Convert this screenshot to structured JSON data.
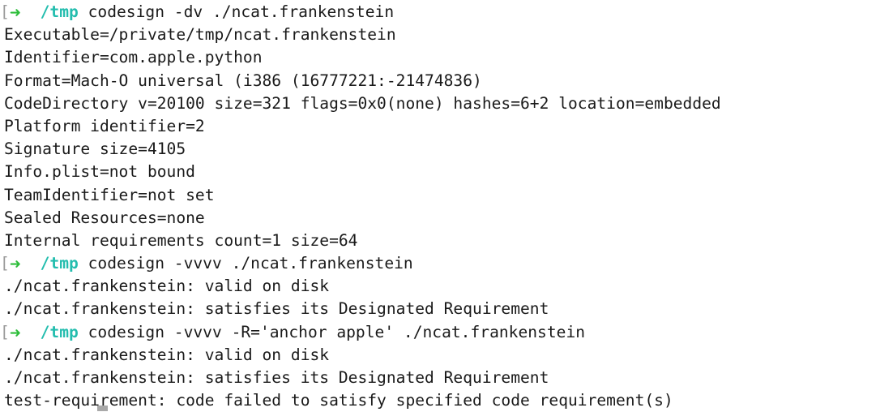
{
  "terminal": {
    "background_color": "#ffffff",
    "foreground_color": "#1a1a1a",
    "prompt_bracket_color": "#9a9a9a",
    "prompt_arrow_color": "#2dbd3a",
    "prompt_cwd_color": "#23bdae",
    "cursor_color": "#a9a9a9",
    "prompt": {
      "bracket": "[",
      "arrow_icon": "arrow-right-icon",
      "arrow": "➜",
      "cwd": "/tmp",
      "gap": "  "
    },
    "lines": [
      {
        "type": "prompt",
        "command": " codesign -dv ./ncat.frankenstein"
      },
      {
        "type": "output",
        "text": "Executable=/private/tmp/ncat.frankenstein"
      },
      {
        "type": "output",
        "text": "Identifier=com.apple.python"
      },
      {
        "type": "output",
        "text": "Format=Mach-O universal (i386 (16777221:-21474836)"
      },
      {
        "type": "output",
        "text": "CodeDirectory v=20100 size=321 flags=0x0(none) hashes=6+2 location=embedded"
      },
      {
        "type": "output",
        "text": "Platform identifier=2"
      },
      {
        "type": "output",
        "text": "Signature size=4105"
      },
      {
        "type": "output",
        "text": "Info.plist=not bound"
      },
      {
        "type": "output",
        "text": "TeamIdentifier=not set"
      },
      {
        "type": "output",
        "text": "Sealed Resources=none"
      },
      {
        "type": "output",
        "text": "Internal requirements count=1 size=64"
      },
      {
        "type": "prompt",
        "command": " codesign -vvvv ./ncat.frankenstein"
      },
      {
        "type": "output",
        "text": "./ncat.frankenstein: valid on disk"
      },
      {
        "type": "output",
        "text": "./ncat.frankenstein: satisfies its Designated Requirement"
      },
      {
        "type": "prompt",
        "command": " codesign -vvvv -R='anchor apple' ./ncat.frankenstein"
      },
      {
        "type": "output",
        "text": "./ncat.frankenstein: valid on disk"
      },
      {
        "type": "output",
        "text": "./ncat.frankenstein: satisfies its Designated Requirement"
      },
      {
        "type": "output",
        "text": "test-requirement: code failed to satisfy specified code requirement(s)"
      }
    ]
  }
}
